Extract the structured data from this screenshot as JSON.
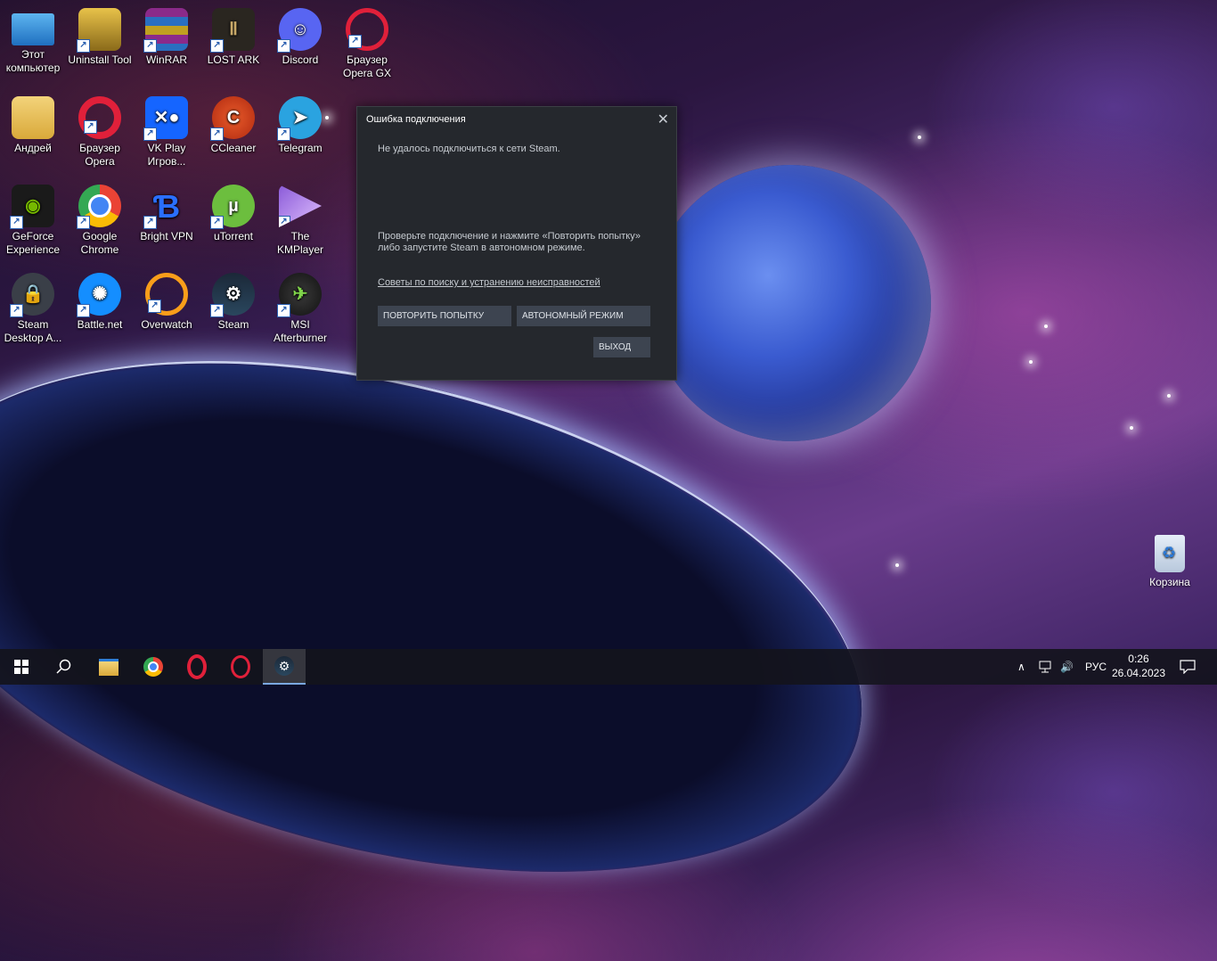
{
  "desktop": {
    "icons": [
      {
        "label": "Этот компьютер"
      },
      {
        "label": "Uninstall Tool"
      },
      {
        "label": "WinRAR"
      },
      {
        "label": "LOST ARK"
      },
      {
        "label": "Discord"
      },
      {
        "label": "Браузер Opera GX"
      },
      {
        "label": "Андрей"
      },
      {
        "label": "Браузер Opera"
      },
      {
        "label": "VK Play Игров..."
      },
      {
        "label": "CCleaner"
      },
      {
        "label": "Telegram"
      },
      {
        "label": "GeForce Experience"
      },
      {
        "label": "Google Chrome"
      },
      {
        "label": "Bright VPN"
      },
      {
        "label": "uTorrent"
      },
      {
        "label": "The KMPlayer"
      },
      {
        "label": "Steam Desktop A..."
      },
      {
        "label": "Battle.net"
      },
      {
        "label": "Overwatch"
      },
      {
        "label": "Steam"
      },
      {
        "label": "MSI Afterburner"
      }
    ],
    "recycle_bin": "Корзина"
  },
  "dialog": {
    "title": "Ошибка подключения",
    "close": "✕",
    "message": "Не удалось подключиться к сети Steam.",
    "hint": "Проверьте подключение и нажмите «Повторить попытку» либо запустите Steam в автономном режиме.",
    "link": "Советы по поиску и устранению неисправностей",
    "retry_label": "ПОВТОРИТЬ ПОПЫТКУ",
    "offline_label": "АВТОНОМНЫЙ РЕЖИМ",
    "exit_label": "ВЫХОД"
  },
  "taskbar": {
    "language": "РУС",
    "time": "0:26",
    "date": "26.04.2023"
  }
}
